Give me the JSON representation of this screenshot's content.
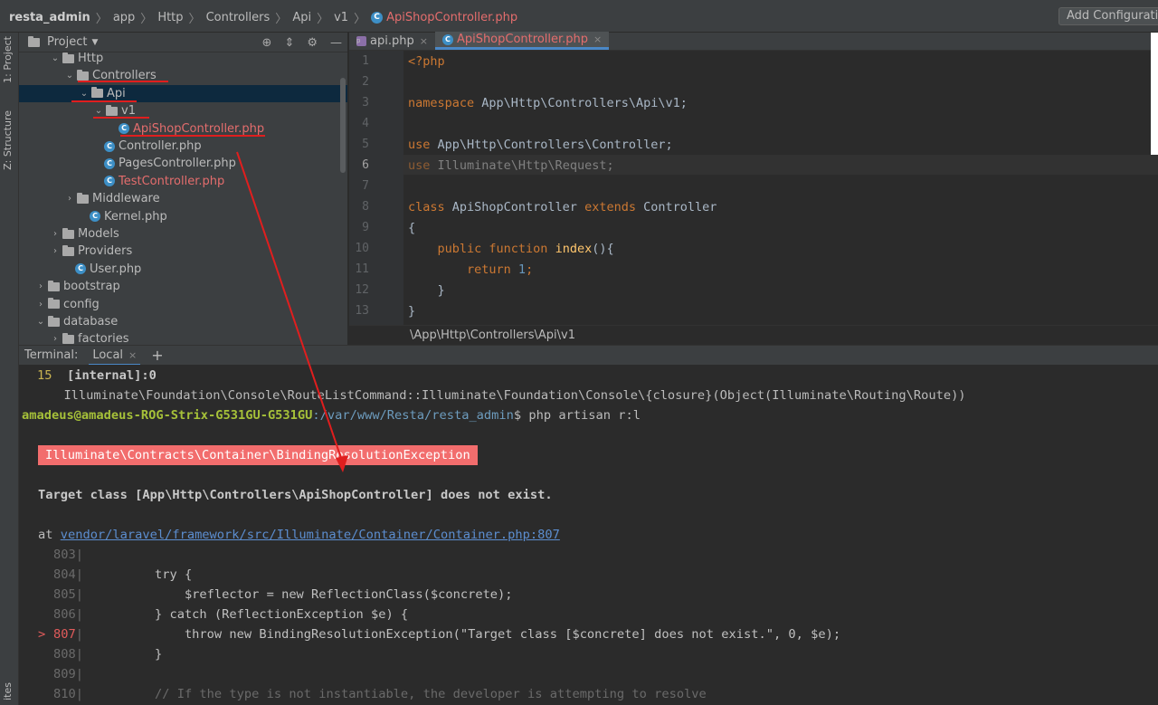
{
  "breadcrumb": {
    "items": [
      "resta_admin",
      "app",
      "Http",
      "Controllers",
      "Api",
      "v1",
      "ApiShopController.php"
    ],
    "add_config": "Add Configurati"
  },
  "left_strip": {
    "project_tab": "1: Project",
    "structure_tab": "Z: Structure",
    "bottom_tab": "ites"
  },
  "project_panel": {
    "title": "Project",
    "tree": [
      {
        "label": "Http",
        "kind": "folder",
        "indent": 2,
        "arrow": "open"
      },
      {
        "label": "Controllers",
        "kind": "folder",
        "indent": 3,
        "arrow": "open"
      },
      {
        "label": "Api",
        "kind": "folder",
        "indent": 4,
        "arrow": "open",
        "selected": true
      },
      {
        "label": "v1",
        "kind": "folder",
        "indent": 5,
        "arrow": "open"
      },
      {
        "label": "ApiShopController.php",
        "kind": "class",
        "indent": 6,
        "red": true
      },
      {
        "label": "Controller.php",
        "kind": "class",
        "indent": 5
      },
      {
        "label": "PagesController.php",
        "kind": "class",
        "indent": 5
      },
      {
        "label": "TestController.php",
        "kind": "class",
        "indent": 5,
        "red": true
      },
      {
        "label": "Middleware",
        "kind": "folder",
        "indent": 3,
        "arrow": "closed"
      },
      {
        "label": "Kernel.php",
        "kind": "class",
        "indent": 4
      },
      {
        "label": "Models",
        "kind": "folder",
        "indent": 2,
        "arrow": "closed"
      },
      {
        "label": "Providers",
        "kind": "folder",
        "indent": 2,
        "arrow": "closed"
      },
      {
        "label": "User.php",
        "kind": "class",
        "indent": 3
      },
      {
        "label": "bootstrap",
        "kind": "folder",
        "indent": 1,
        "arrow": "closed"
      },
      {
        "label": "config",
        "kind": "folder",
        "indent": 1,
        "arrow": "closed"
      },
      {
        "label": "database",
        "kind": "folder",
        "indent": 1,
        "arrow": "open"
      },
      {
        "label": "factories",
        "kind": "folder",
        "indent": 2,
        "arrow": "closed"
      }
    ]
  },
  "editor": {
    "tabs": [
      {
        "label": "api.php",
        "active": false
      },
      {
        "label": "ApiShopController.php",
        "active": true
      }
    ],
    "lines": [
      "1",
      "2",
      "3",
      "4",
      "5",
      "6",
      "7",
      "8",
      "9",
      "10",
      "11",
      "12",
      "13"
    ],
    "code": {
      "l1": "<?php",
      "l3_kw": "namespace",
      "l3_rest": " App\\Http\\Controllers\\Api\\v1;",
      "l5_kw": "use",
      "l5_rest": " App\\Http\\Controllers\\Controller;",
      "l6_kw": "use",
      "l6_rest": " Illuminate\\Http\\Request;",
      "l8_kw": "class",
      "l8_name": " ApiShopController ",
      "l8_ext": "extends",
      "l8_parent": " Controller",
      "l9": "{",
      "l10_kw": "    public function ",
      "l10_fn": "index",
      "l10_rest": "(){",
      "l11_kw": "        return ",
      "l11_num": "1",
      "l11_rest": ";",
      "l12": "    }",
      "l13": "}"
    },
    "footer_path": "\\App\\Http\\Controllers\\Api\\v1"
  },
  "terminal": {
    "label": "Terminal:",
    "tab": "Local",
    "line1_num": "15",
    "line1_text": "  [internal]:0",
    "line2": "      Illuminate\\Foundation\\Console\\RouteListCommand::Illuminate\\Foundation\\Console\\{closure}(Object(Illuminate\\Routing\\Route))",
    "prompt_user": "amadeus@amadeus-ROG-Strix-G531GU-G531GU",
    "prompt_path": ":/var/www/Resta/resta_admin",
    "prompt_cmd": "$ php artisan r:l",
    "exception": "Illuminate\\Contracts\\Container\\BindingResolutionException",
    "message": "Target class [App\\Http\\Controllers\\ApiShopController] does not exist.",
    "at": "at ",
    "at_link": "vendor/laravel/framework/src/Illuminate/Container/Container.php:807",
    "src_lines": [
      {
        "n": "803",
        "marker": "",
        "text": ""
      },
      {
        "n": "804",
        "marker": "",
        "text": "try {"
      },
      {
        "n": "805",
        "marker": "",
        "text": "    $reflector = new ReflectionClass($concrete);"
      },
      {
        "n": "806",
        "marker": "",
        "text": "} catch (ReflectionException $e) {"
      },
      {
        "n": "807",
        "marker": ">",
        "text": "    throw new BindingResolutionException(\"Target class [$concrete] does not exist.\", 0, $e);"
      },
      {
        "n": "808",
        "marker": "",
        "text": "}"
      },
      {
        "n": "809",
        "marker": "",
        "text": ""
      },
      {
        "n": "810",
        "marker": "",
        "text": "// If the type is not instantiable, the developer is attempting to resolve"
      }
    ]
  }
}
